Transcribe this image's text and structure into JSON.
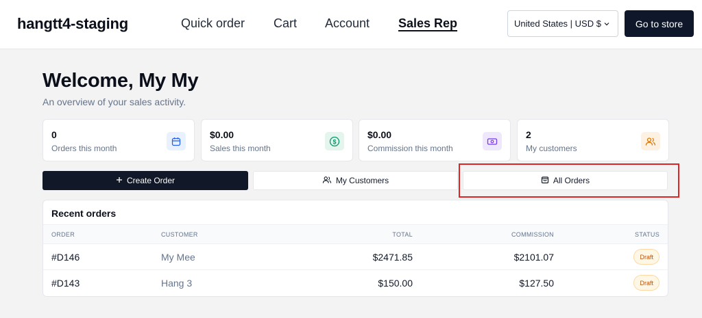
{
  "header": {
    "brand": "hangtt4-staging",
    "nav": [
      {
        "label": "Quick order",
        "active": false
      },
      {
        "label": "Cart",
        "active": false
      },
      {
        "label": "Account",
        "active": false
      },
      {
        "label": "Sales Rep",
        "active": true
      }
    ],
    "region_label": "United States | USD $",
    "store_button": "Go to store"
  },
  "main": {
    "title": "Welcome, My My",
    "subtitle": "An overview of your sales activity.",
    "stats": [
      {
        "value": "0",
        "label": "Orders this month",
        "icon": "calendar-icon",
        "color": "#2563eb"
      },
      {
        "value": "$0.00",
        "label": "Sales this month",
        "icon": "dollar-icon",
        "color": "#059669"
      },
      {
        "value": "$0.00",
        "label": "Commission this month",
        "icon": "banknote-icon",
        "color": "#7c3aed"
      },
      {
        "value": "2",
        "label": "My customers",
        "icon": "users-icon",
        "color": "#d97706"
      }
    ],
    "actions": {
      "create_order": "Create Order",
      "my_customers": "My Customers",
      "all_orders": "All Orders"
    },
    "recent_orders": {
      "title": "Recent orders",
      "columns": [
        "ORDER",
        "CUSTOMER",
        "TOTAL",
        "COMMISSION",
        "STATUS"
      ],
      "rows": [
        {
          "order": "#D146",
          "customer": "My Mee",
          "total": "$2471.85",
          "commission": "$2101.07",
          "status": "Draft"
        },
        {
          "order": "#D143",
          "customer": "Hang 3",
          "total": "$150.00",
          "commission": "$127.50",
          "status": "Draft"
        }
      ]
    }
  },
  "colors": {
    "primary_dark": "#0f172a",
    "highlight": "#dc2626",
    "draft_badge": "#b45309"
  }
}
